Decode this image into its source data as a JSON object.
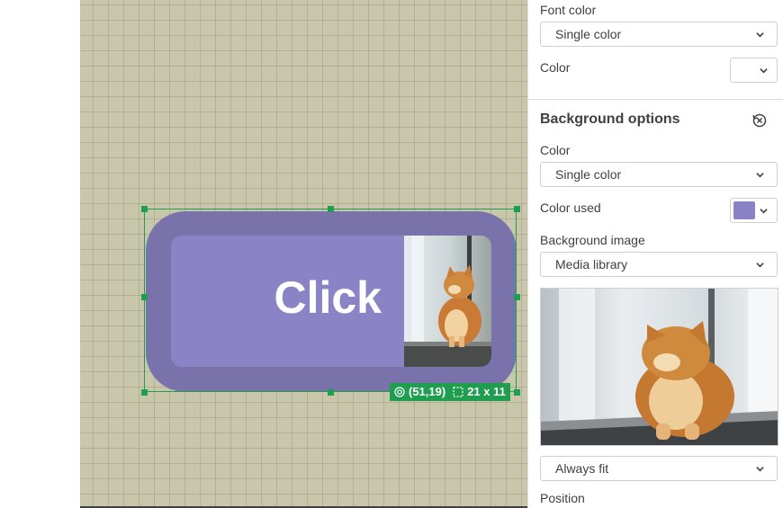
{
  "canvas": {
    "button": {
      "label": "Click",
      "image_alt": "cat-photo"
    },
    "selection": {
      "position": "(51,19)",
      "size": "21 x 11"
    }
  },
  "panel": {
    "font_color": {
      "label": "Font color",
      "mode": "Single color",
      "color_label": "Color"
    },
    "background": {
      "title": "Background options",
      "color_label": "Color",
      "color_mode": "Single color",
      "color_used_label": "Color used",
      "color_used_value": "#8a84c6",
      "image_label": "Background image",
      "image_source": "Media library",
      "fit": "Always fit",
      "position_label": "Position"
    }
  },
  "icons": {
    "reset": "reset-icon",
    "chevron": "chevron-down-icon",
    "position": "target-icon",
    "size": "resize-icon"
  }
}
